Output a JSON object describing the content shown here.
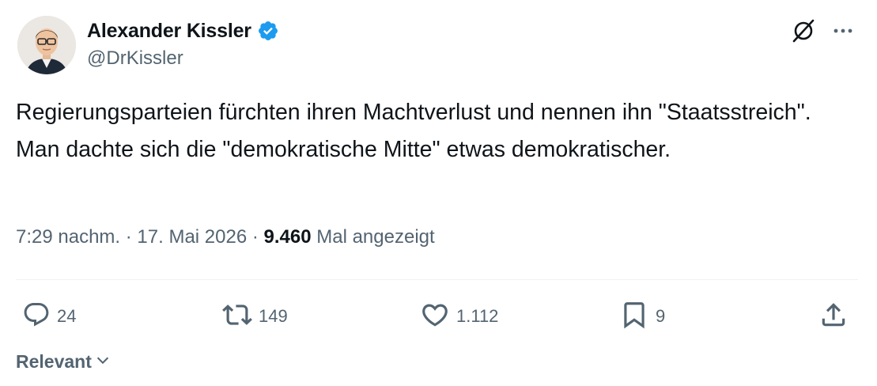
{
  "author": {
    "display_name": "Alexander Kissler",
    "handle": "@DrKissler",
    "verified": true
  },
  "tweet": {
    "text": "Regierungsparteien fürchten ihren Machtverlust und nennen ihn \"Staatsstreich\". Man dachte sich die \"demokratische Mitte\" etwas demokratischer."
  },
  "meta": {
    "time": "7:29 nachm.",
    "separator_1": " · ",
    "date": "17. Mai 2026",
    "separator_2": " · ",
    "views_count": "9.460",
    "views_label": " Mal angezeigt"
  },
  "actions": {
    "replies": "24",
    "reposts": "149",
    "likes": "1.112",
    "bookmarks": "9"
  },
  "sort": {
    "label": "Relevant"
  },
  "icons": {
    "verified": "verified-badge-icon",
    "grok": "grok-icon",
    "more": "more-icon",
    "reply": "reply-icon",
    "repost": "repost-icon",
    "like": "heart-icon",
    "bookmark": "bookmark-icon",
    "share": "share-icon",
    "chevron": "chevron-down-icon"
  },
  "colors": {
    "text_primary": "#0f1419",
    "text_secondary": "#536471",
    "verified_blue": "#1d9bf0",
    "divider": "#eff3f4"
  }
}
